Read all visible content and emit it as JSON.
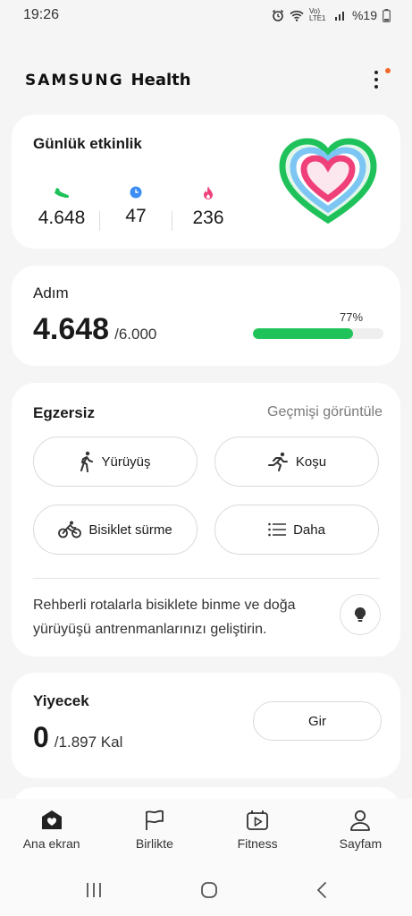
{
  "status_bar": {
    "time": "19:26",
    "network": "Vo) LTE1",
    "battery": "%19"
  },
  "header": {
    "brand_samsung": "SAMSUNG",
    "brand_health": "Health"
  },
  "daily_activity": {
    "title": "Günlük etkinlik",
    "steps": "4.648",
    "active_minutes": "47",
    "calories": "236",
    "colors": {
      "steps": "#1fc25a",
      "minutes": "#3a8df5",
      "calories": "#f0407a"
    }
  },
  "steps_card": {
    "title": "Adım",
    "value": "4.648",
    "goal": "/6.000",
    "percent_label": "77%",
    "progress": 0.77,
    "bar_color": "#20c35a"
  },
  "exercise": {
    "title": "Egzersiz",
    "history_link": "Geçmişi görüntüle",
    "buttons": {
      "walk": "Yürüyüş",
      "run": "Koşu",
      "bike": "Bisiklet sürme",
      "more": "Daha"
    },
    "tip": "Rehberli rotalarla bisiklete binme ve doğa yürüyüşü antrenmanlarınızı geliştirin."
  },
  "food": {
    "title": "Yiyecek",
    "value": "0",
    "goal": "/1.897 Kal",
    "enter_button": "Gir"
  },
  "bottom_nav": {
    "home": "Ana ekran",
    "together": "Birlikte",
    "fitness": "Fitness",
    "my_page": "Sayfam"
  }
}
